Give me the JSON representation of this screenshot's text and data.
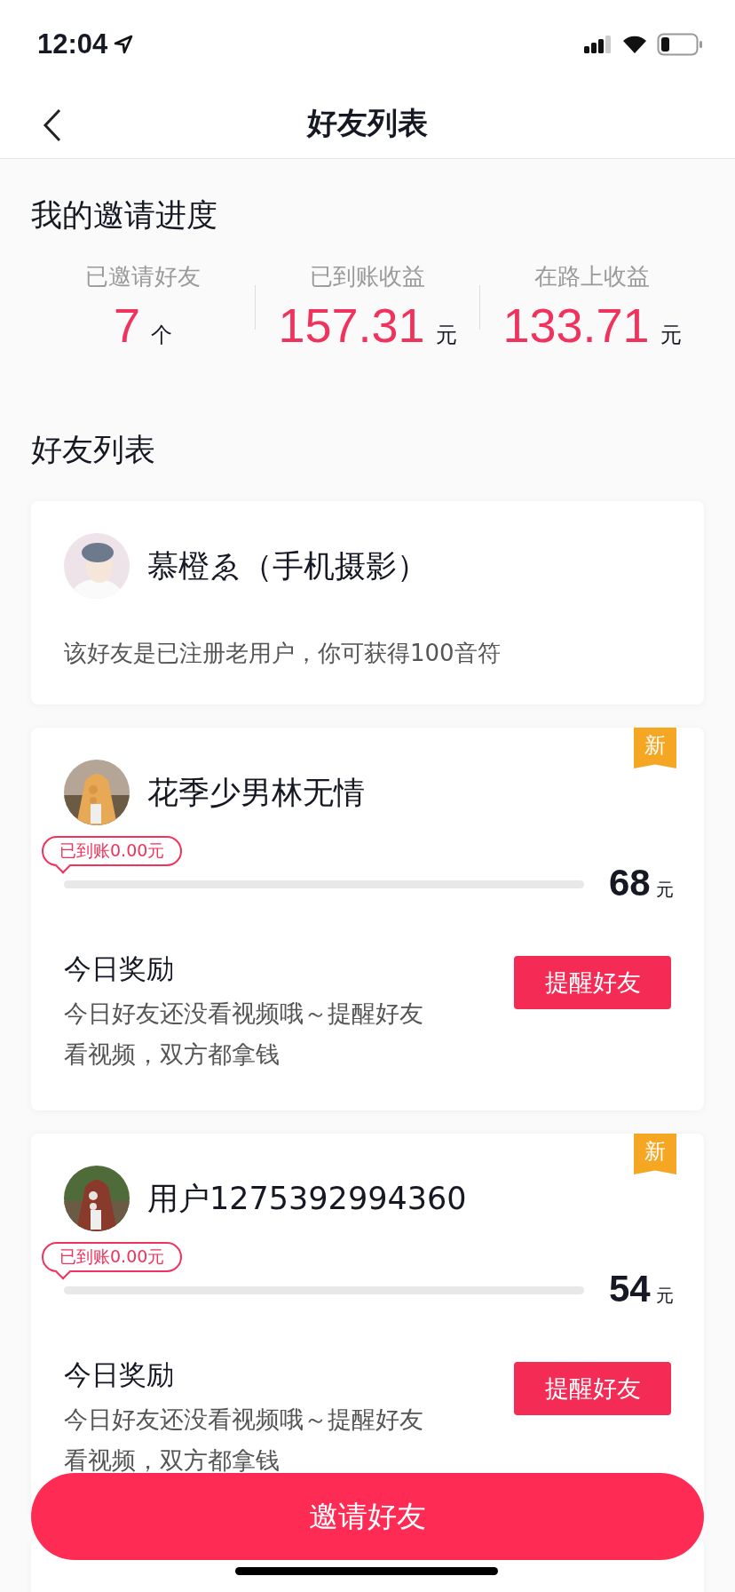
{
  "status_bar": {
    "time": "12:04"
  },
  "header": {
    "title": "好友列表"
  },
  "progress": {
    "title": "我的邀请进度",
    "stats": [
      {
        "label": "已邀请好友",
        "value": "7",
        "unit": "个"
      },
      {
        "label": "已到账收益",
        "value": "157.31",
        "unit": "元"
      },
      {
        "label": "在路上收益",
        "value": "133.71",
        "unit": "元"
      }
    ]
  },
  "friends_title": "好友列表",
  "friends": [
    {
      "kind": "registered",
      "name": "慕橙ゑ（手机摄影）",
      "note": "该好友是已注册老用户，你可获得100音符"
    },
    {
      "kind": "invited",
      "badge": "新",
      "name": "花季少男林无情",
      "tag": "已到账0.00元",
      "level": 0,
      "target": "68",
      "unit": "元",
      "reward_title": "今日奖励",
      "reward_text": "今日好友还没看视频哦～提醒好友看视频，双方都拿钱",
      "button": "提醒好友"
    },
    {
      "kind": "invited",
      "badge": "新",
      "name": "用户1275392994360",
      "tag": "已到账0.00元",
      "level": 0,
      "target": "54",
      "unit": "元",
      "reward_title": "今日奖励",
      "reward_text": "今日好友还没看视频哦～提醒好友看视频，双方都拿钱",
      "button": "提醒好友"
    }
  ],
  "invite_button": "邀请好友"
}
